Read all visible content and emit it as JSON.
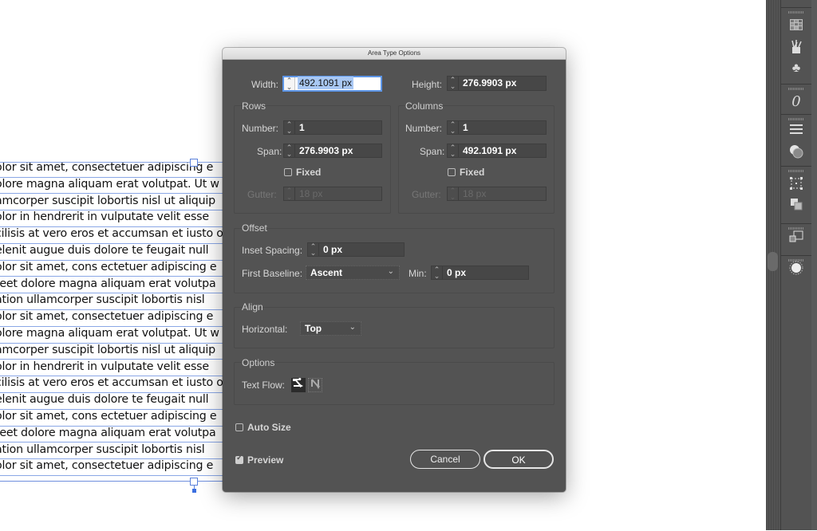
{
  "canvas": {
    "text_lines": [
      "olor sit amet, consectetuer adipiscing e",
      "olore magna aliquam erat volutpat. Ut w",
      "amcorper suscipit lobortis nisl ut aliquip",
      "olor in hendrerit in vulputate velit esse",
      "cilisis at vero eros et accumsan et iusto o",
      "elenit augue duis dolore te feugait null",
      "olor sit amet, cons ectetuer adipiscing e",
      "reet dolore magna aliquam erat volutpa",
      "ation ullamcorper suscipit lobortis nisl",
      "olor sit amet, consectetuer adipiscing e",
      "olore magna aliquam erat volutpat. Ut w",
      "amcorper suscipit lobortis nisl ut aliquip",
      "olor in hendrerit in vulputate velit esse",
      "cilisis at vero eros et accumsan et iusto o",
      "elenit augue duis dolore te feugait null",
      "olor sit amet, cons ectetuer adipiscing e",
      "reet dolore magna aliquam erat volutpa",
      "ation ullamcorper suscipit lobortis nisl",
      "olor sit amet, consectetuer adipiscing e"
    ],
    "selection_color": "#5b82db"
  },
  "dialog": {
    "title": "Area Type Options",
    "width_label": "Width:",
    "width_value": "492.1091 px",
    "height_label": "Height:",
    "height_value": "276.9903 px",
    "rows": {
      "title": "Rows",
      "number_label": "Number:",
      "number_value": "1",
      "span_label": "Span:",
      "span_value": "276.9903 px",
      "fixed_label": "Fixed",
      "fixed_checked": false,
      "gutter_label": "Gutter:",
      "gutter_value": "18 px"
    },
    "columns": {
      "title": "Columns",
      "number_label": "Number:",
      "number_value": "1",
      "span_label": "Span:",
      "span_value": "492.1091 px",
      "fixed_label": "Fixed",
      "fixed_checked": false,
      "gutter_label": "Gutter:",
      "gutter_value": "18 px"
    },
    "offset": {
      "title": "Offset",
      "inset_label": "Inset Spacing:",
      "inset_value": "0 px",
      "baseline_label": "First Baseline:",
      "baseline_value": "Ascent",
      "min_label": "Min:",
      "min_value": "0 px"
    },
    "align": {
      "title": "Align",
      "horizontal_label": "Horizontal:",
      "horizontal_value": "Top"
    },
    "options": {
      "title": "Options",
      "text_flow_label": "Text Flow:",
      "flow_rows_icon": "text-flow-by-rows-icon",
      "flow_columns_icon": "text-flow-by-columns-icon",
      "selected_flow": "rows"
    },
    "auto_size_label": "Auto Size",
    "auto_size_checked": false,
    "preview_label": "Preview",
    "preview_checked": true,
    "cancel_label": "Cancel",
    "ok_label": "OK",
    "accent_color": "#5d95e6"
  },
  "dock": {
    "icons": [
      "swatches-icon",
      "brushes-icon",
      "symbols-icon",
      "glyphs-icon",
      "paragraph-icon",
      "transparency-icon",
      "transform-icon",
      "pathfinder-icon",
      "artboards-icon",
      "appearance-icon"
    ]
  }
}
